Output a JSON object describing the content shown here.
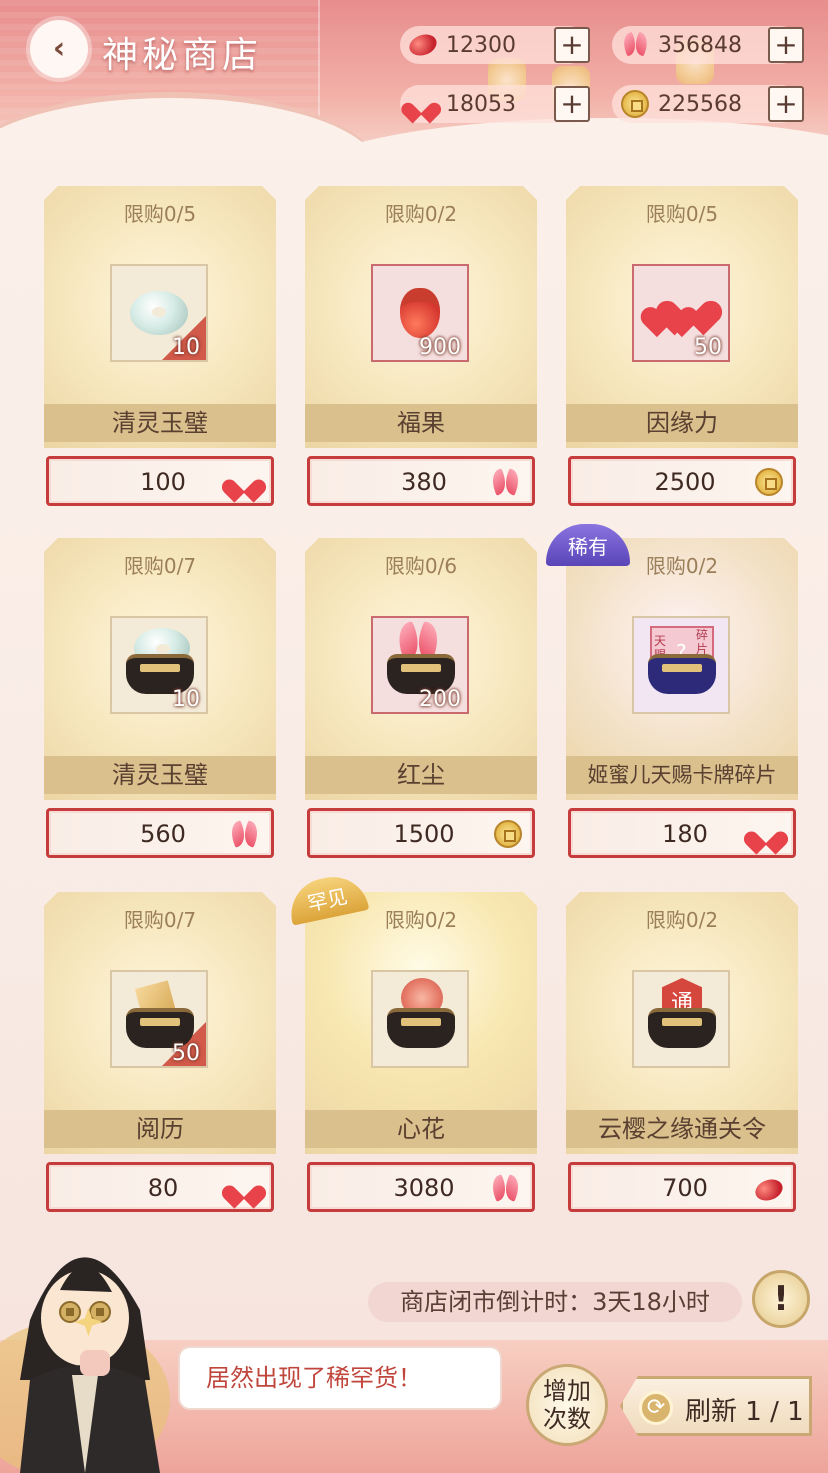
{
  "header": {
    "title": "神秘商店",
    "currencies": [
      {
        "icon": "red-bean-icon",
        "value": "12300"
      },
      {
        "icon": "butterfly-icon",
        "value": "356848"
      },
      {
        "icon": "heart-icon",
        "value": "18053"
      },
      {
        "icon": "coin-icon",
        "value": "225568"
      }
    ],
    "plus_label": "+"
  },
  "shop": {
    "items": [
      {
        "limit": "限购0/5",
        "name": "清灵玉璧",
        "qty": "10",
        "price": "100",
        "price_icon": "heart-icon",
        "art": "jade-disc-icon"
      },
      {
        "limit": "限购0/2",
        "name": "福果",
        "qty": "900",
        "price": "380",
        "price_icon": "butterfly-icon",
        "art": "acorn-icon"
      },
      {
        "limit": "限购0/5",
        "name": "因缘力",
        "qty": "50",
        "price": "2500",
        "price_icon": "coin-icon",
        "art": "hearts-icon"
      },
      {
        "limit": "限购0/7",
        "name": "清灵玉璧",
        "qty": "10",
        "price": "560",
        "price_icon": "butterfly-icon",
        "art": "jade-pouch-icon"
      },
      {
        "limit": "限购0/6",
        "name": "红尘",
        "qty": "200",
        "price": "1500",
        "price_icon": "coin-icon",
        "art": "feather-pouch-icon"
      },
      {
        "limit": "限购0/2",
        "name": "姬蜜儿天赐卡牌碎片",
        "qty": "",
        "price": "180",
        "price_icon": "heart-icon",
        "art": "card-fragment-icon",
        "rarity": "稀有"
      },
      {
        "limit": "限购0/7",
        "name": "阅历",
        "qty": "50",
        "price": "80",
        "price_icon": "heart-icon",
        "art": "ticket-pouch-icon"
      },
      {
        "limit": "限购0/2",
        "name": "心花",
        "qty": "",
        "price": "3080",
        "price_icon": "butterfly-icon",
        "art": "flower-pouch-icon",
        "rarity": "罕见"
      },
      {
        "limit": "限购0/2",
        "name": "云樱之缘通关令",
        "qty": "",
        "price": "700",
        "price_icon": "red-bean-icon",
        "art": "pass-token-icon"
      }
    ]
  },
  "footer": {
    "timer": "商店闭市倒计时：3天18小时",
    "info_label": "!",
    "speech": "居然出现了稀罕货！",
    "add_count_line1": "增加",
    "add_count_line2": "次数",
    "refresh_label": "刷新 1 / 1",
    "token_char": "通",
    "fragment_left": "天赐",
    "fragment_right": "碎片"
  },
  "colors": {
    "accent_red": "#c63b3b",
    "gold": "#d9c08d",
    "rare_purple": "#6b52c9",
    "uncommon_gold": "#e6b045"
  }
}
